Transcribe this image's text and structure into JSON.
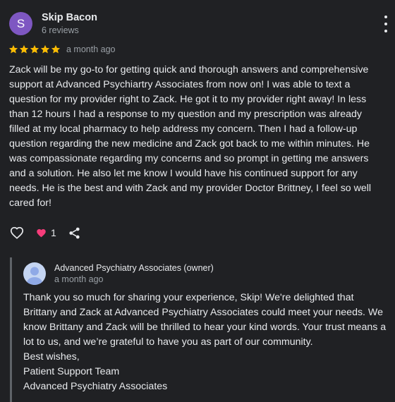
{
  "review": {
    "avatar_letter": "S",
    "avatar_color": "#7e57c2",
    "author": "Skip Bacon",
    "review_count": "6 reviews",
    "rating": 5,
    "date": "a month ago",
    "text": "Zack will be my go-to for getting quick and thorough answers and comprehensive support at Advanced Psychiartry Associates from now on! I was able to text a question for my provider right to Zack. He got it to my provider right away! In less than 12 hours I had a response to my question and my prescription was already filled at my local pharmacy to help address my concern. Then I had a follow-up question regarding the new medicine and Zack got back to me within minutes. He was compassionate regarding my concerns and so prompt in getting me answers and a solution. He also let me know I would have his continued support for any needs. He is the best and with Zack and my provider Doctor Brittney, I feel so well cared for!"
  },
  "actions": {
    "reaction_count": "1",
    "heart_color": "#f63c7a"
  },
  "reply": {
    "owner_name": "Advanced Psychiatry Associates (owner)",
    "date": "a month ago",
    "lines": [
      "Thank you so much for sharing your experience, Skip! We're delighted that Brittany and Zack at Advanced Psychiatry Associates could meet your needs. We know Brittany and Zack will be thrilled to hear your kind words. Your trust means a lot to us, and we’re grateful to have you as part of our community.",
      "Best wishes,",
      "Patient Support Team",
      "Advanced Psychiatry Associates"
    ]
  },
  "colors": {
    "background": "#202124",
    "text": "#e8eaed",
    "secondary_text": "#9aa0a6",
    "star": "#fbbc04"
  },
  "icons": [
    "more-vert-icon",
    "star-icon",
    "heart-outline-icon",
    "heart-filled-icon",
    "share-icon",
    "default-avatar-icon"
  ]
}
